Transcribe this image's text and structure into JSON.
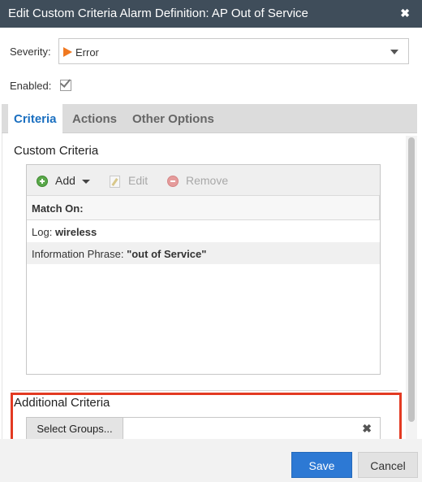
{
  "dialog": {
    "title": "Edit Custom Criteria Alarm Definition: AP Out of Service",
    "close_glyph": "✖"
  },
  "form": {
    "severity_label": "Severity:",
    "severity_value": "Error",
    "severity_icon": "flag-icon",
    "severity_color": "#f07820",
    "enabled_label": "Enabled:",
    "enabled_checked": true
  },
  "tabs": [
    {
      "label": "Criteria",
      "active": true
    },
    {
      "label": "Actions",
      "active": false
    },
    {
      "label": "Other Options",
      "active": false
    }
  ],
  "custom_criteria": {
    "title": "Custom Criteria",
    "toolbar": {
      "add_label": "Add",
      "edit_label": "Edit",
      "remove_label": "Remove"
    },
    "column_header": "Match On:",
    "rows": [
      {
        "key": "Log:",
        "value": "wireless"
      },
      {
        "key": "Information Phrase:",
        "value": "\"out of Service\""
      }
    ]
  },
  "additional_criteria": {
    "title": "Additional Criteria",
    "select_groups_label": "Select Groups...",
    "clear_glyph": "✖",
    "highlight_color": "#e33a22"
  },
  "footer": {
    "save_label": "Save",
    "cancel_label": "Cancel"
  },
  "colors": {
    "titlebar": "#3f4d5a",
    "accent": "#1a6fc0",
    "primary_button": "#2d79d4"
  }
}
